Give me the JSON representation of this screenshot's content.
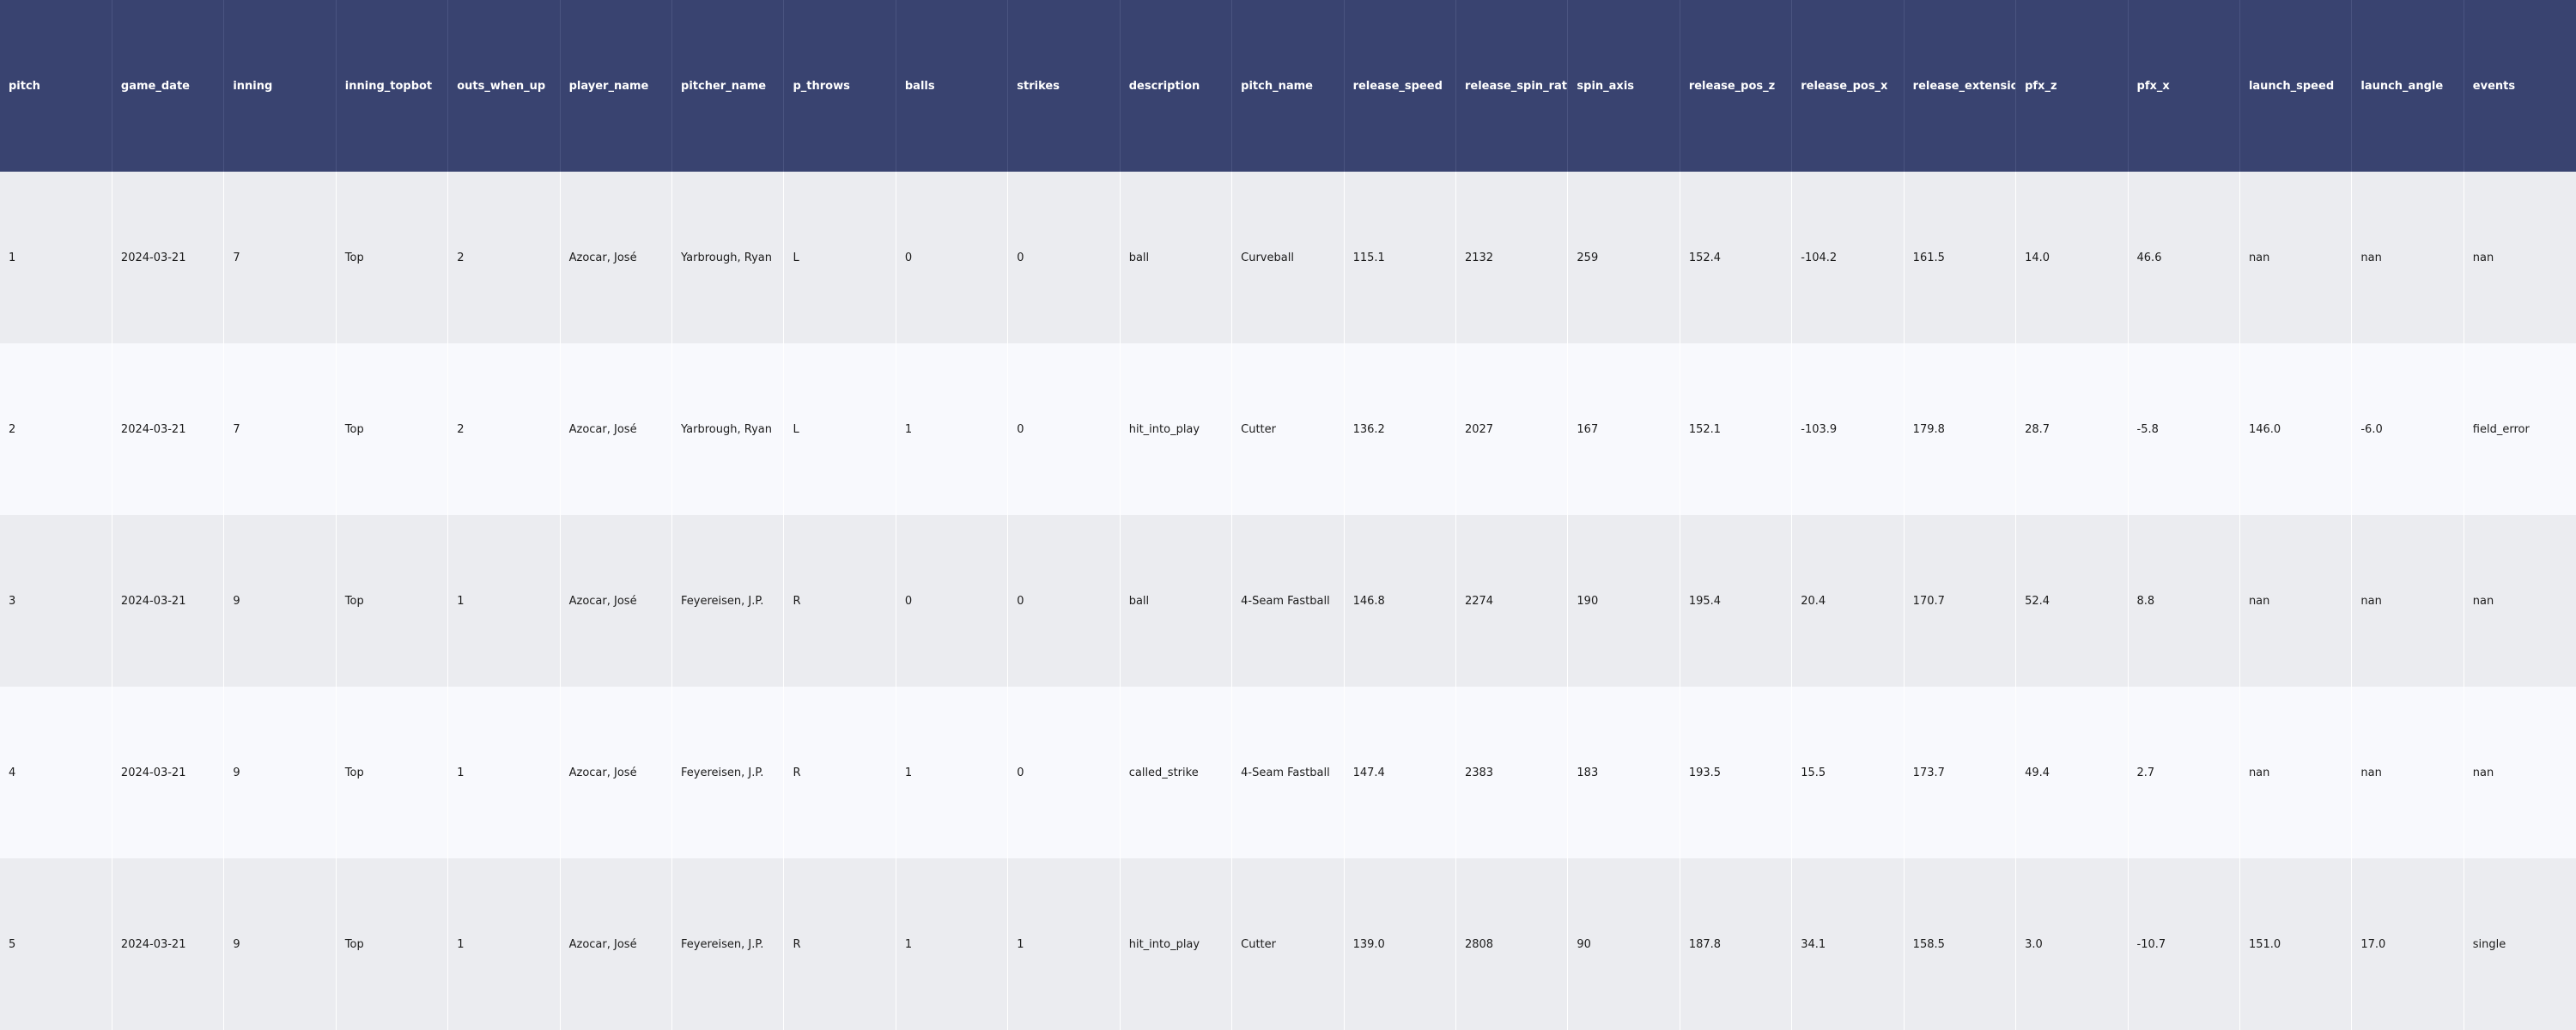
{
  "table": {
    "columns": [
      "pitch",
      "game_date",
      "inning",
      "inning_topbot",
      "outs_when_up",
      "player_name",
      "pitcher_name",
      "p_throws",
      "balls",
      "strikes",
      "description",
      "pitch_name",
      "release_speed",
      "release_spin_rate",
      "spin_axis",
      "release_pos_z",
      "release_pos_x",
      "release_extension",
      "pfx_z",
      "pfx_x",
      "launch_speed",
      "launch_angle",
      "events"
    ],
    "rows": [
      [
        "1",
        "2024-03-21",
        "7",
        "Top",
        "2",
        "Azocar, José",
        "Yarbrough, Ryan",
        "L",
        "0",
        "0",
        "ball",
        "Curveball",
        "115.1",
        "2132",
        "259",
        "152.4",
        "-104.2",
        "161.5",
        "14.0",
        "46.6",
        "nan",
        "nan",
        "nan"
      ],
      [
        "2",
        "2024-03-21",
        "7",
        "Top",
        "2",
        "Azocar, José",
        "Yarbrough, Ryan",
        "L",
        "1",
        "0",
        "hit_into_play",
        "Cutter",
        "136.2",
        "2027",
        "167",
        "152.1",
        "-103.9",
        "179.8",
        "28.7",
        "-5.8",
        "146.0",
        "-6.0",
        "field_error"
      ],
      [
        "3",
        "2024-03-21",
        "9",
        "Top",
        "1",
        "Azocar, José",
        "Feyereisen, J.P.",
        "R",
        "0",
        "0",
        "ball",
        "4-Seam Fastball",
        "146.8",
        "2274",
        "190",
        "195.4",
        "20.4",
        "170.7",
        "52.4",
        "8.8",
        "nan",
        "nan",
        "nan"
      ],
      [
        "4",
        "2024-03-21",
        "9",
        "Top",
        "1",
        "Azocar, José",
        "Feyereisen, J.P.",
        "R",
        "1",
        "0",
        "called_strike",
        "4-Seam Fastball",
        "147.4",
        "2383",
        "183",
        "193.5",
        "15.5",
        "173.7",
        "49.4",
        "2.7",
        "nan",
        "nan",
        "nan"
      ],
      [
        "5",
        "2024-03-21",
        "9",
        "Top",
        "1",
        "Azocar, José",
        "Feyereisen, J.P.",
        "R",
        "1",
        "1",
        "hit_into_play",
        "Cutter",
        "139.0",
        "2808",
        "90",
        "187.8",
        "34.1",
        "158.5",
        "3.0",
        "-10.7",
        "151.0",
        "17.0",
        "single"
      ]
    ]
  },
  "colors": {
    "header_bg": "#394370",
    "header_text": "#ffffff",
    "row_odd": "#ebecf0",
    "row_even": "#f8f9fd"
  }
}
